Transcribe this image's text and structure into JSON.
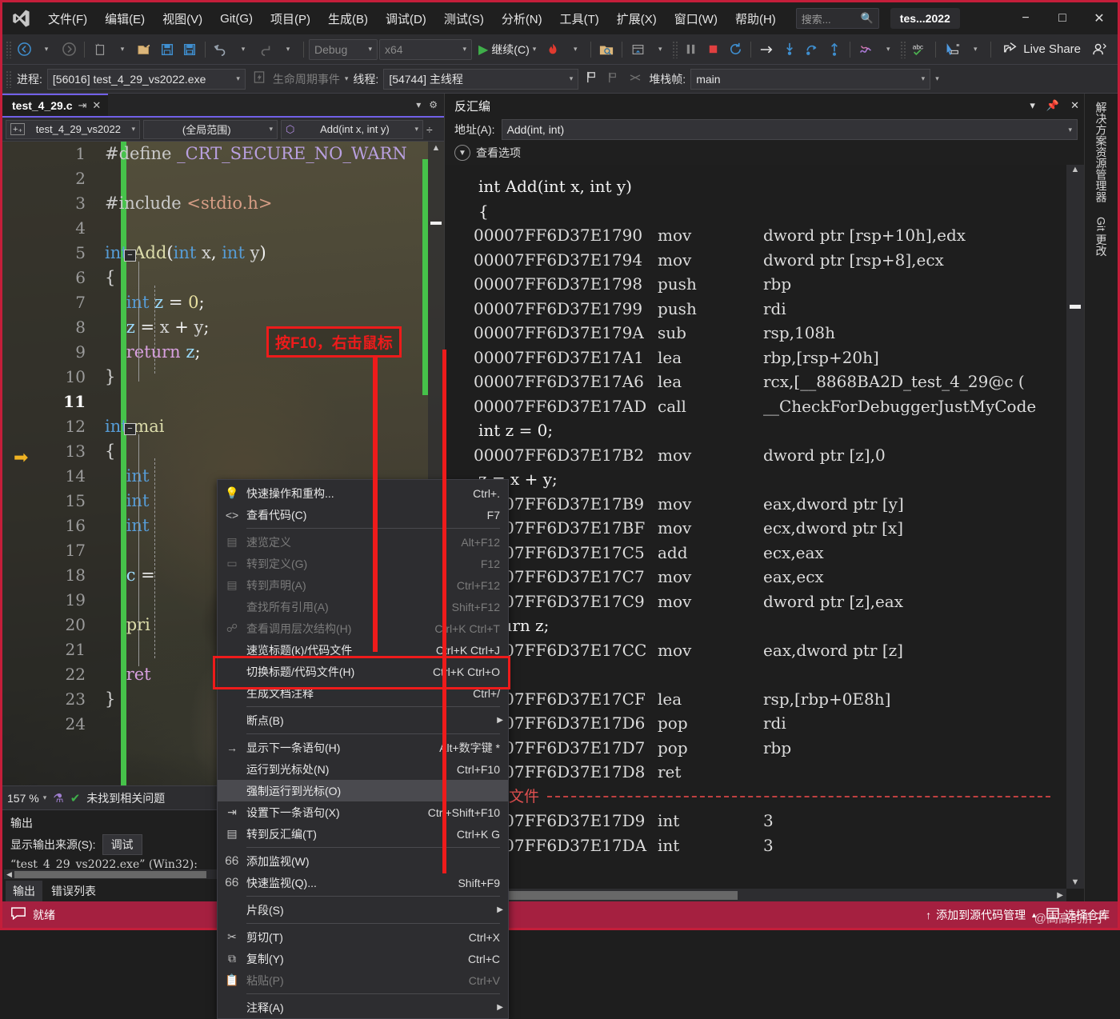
{
  "window": {
    "title": "tes...2022",
    "search_placeholder": "搜索...",
    "minimize": "−",
    "maximize": "□",
    "close": "✕"
  },
  "menubar": {
    "items": [
      {
        "label": "文件(F)"
      },
      {
        "label": "编辑(E)"
      },
      {
        "label": "视图(V)"
      },
      {
        "label": "Git(G)"
      },
      {
        "label": "项目(P)"
      },
      {
        "label": "生成(B)"
      },
      {
        "label": "调试(D)"
      },
      {
        "label": "测试(S)"
      },
      {
        "label": "分析(N)"
      },
      {
        "label": "工具(T)"
      },
      {
        "label": "扩展(X)"
      },
      {
        "label": "窗口(W)"
      },
      {
        "label": "帮助(H)"
      }
    ]
  },
  "toolbar": {
    "config": "Debug",
    "platform": "x64",
    "continue_label": "继续(C)",
    "live_share": "Live Share"
  },
  "debugbar": {
    "process_label": "进程:",
    "process_value": "[56016] test_4_29_vs2022.exe",
    "lifecycle_label": "生命周期事件",
    "thread_label": "线程:",
    "thread_value": "[54744] 主线程",
    "stackframe_label": "堆栈帧:",
    "stackframe_value": "main"
  },
  "editor": {
    "tab_name": "test_4_29.c",
    "nav_project": "test_4_29_vs2022",
    "nav_scope": "(全局范围)",
    "nav_member": "Add(int x, int y)",
    "zoom": "157 %",
    "problems": "未找到相关问题",
    "lines": [
      {
        "n": "1",
        "html": "<span class='pp2'>#define</span> <span class='pp'>_CRT_SECURE_NO_WARN</span>"
      },
      {
        "n": "2",
        "html": ""
      },
      {
        "n": "3",
        "html": "<span class='pp2'>#include</span> <span class='str'>&lt;stdio.h&gt;</span>"
      },
      {
        "n": "4",
        "html": ""
      },
      {
        "n": "5",
        "html": "<span class='k'>int</span> <span class='fn'>Add</span>(<span class='k'>int</span> <span class='pl'>x</span>, <span class='k'>int</span> <span class='pl'>y</span>)"
      },
      {
        "n": "6",
        "html": "<span class='pl'>{</span>"
      },
      {
        "n": "7",
        "html": "    <span class='k'>int</span> <span class='id'>z</span> = <span class='num'>0</span>;"
      },
      {
        "n": "8",
        "html": "    <span class='id'>z</span> = <span class='pl'>x</span> + <span class='pl'>y</span>;"
      },
      {
        "n": "9",
        "html": "    <span class='ret'>return</span> <span class='id'>z</span>;"
      },
      {
        "n": "10",
        "html": "<span class='pl'>}</span>"
      },
      {
        "n": "11",
        "html": "",
        "current": true
      },
      {
        "n": "12",
        "html": "<span class='k'>int</span> <span class='fn'>mai</span>"
      },
      {
        "n": "13",
        "html": "<span class='pl'>{</span>"
      },
      {
        "n": "14",
        "html": "    <span class='k'>int</span>"
      },
      {
        "n": "15",
        "html": "    <span class='k'>int</span>"
      },
      {
        "n": "16",
        "html": "    <span class='k'>int</span>"
      },
      {
        "n": "17",
        "html": ""
      },
      {
        "n": "18",
        "html": "    <span class='id'>c</span> ="
      },
      {
        "n": "19",
        "html": ""
      },
      {
        "n": "20",
        "html": "    <span class='fn'>pri</span>"
      },
      {
        "n": "21",
        "html": ""
      },
      {
        "n": "22",
        "html": "    <span class='ret'>ret</span>"
      },
      {
        "n": "23",
        "html": "<span class='pl'>}</span>"
      },
      {
        "n": "24",
        "html": ""
      }
    ]
  },
  "output": {
    "title": "输出",
    "source_label": "显示输出来源(S):",
    "source_value": "调试",
    "line": "“test_4_29_vs2022.exe” (Win32):",
    "tabs": [
      {
        "label": "输出",
        "active": true
      },
      {
        "label": "错误列表",
        "active": false
      }
    ]
  },
  "disassembly": {
    "title": "反汇编",
    "address_label": "地址(A):",
    "address_value": "Add(int, int)",
    "view_options": "查看选项",
    "no_source_label": "无源文件",
    "rows": [
      {
        "type": "src",
        "text": "int Add(int x, int y)"
      },
      {
        "type": "src",
        "text": "{"
      },
      {
        "type": "asm",
        "addr": "00007FF6D37E1790",
        "mn": "mov",
        "op": "dword ptr [rsp+10h],edx"
      },
      {
        "type": "asm",
        "addr": "00007FF6D37E1794",
        "mn": "mov",
        "op": "dword ptr [rsp+8],ecx"
      },
      {
        "type": "asm",
        "addr": "00007FF6D37E1798",
        "mn": "push",
        "op": "rbp"
      },
      {
        "type": "asm",
        "addr": "00007FF6D37E1799",
        "mn": "push",
        "op": "rdi"
      },
      {
        "type": "asm",
        "addr": "00007FF6D37E179A",
        "mn": "sub",
        "op": "rsp,108h"
      },
      {
        "type": "asm",
        "addr": "00007FF6D37E17A1",
        "mn": "lea",
        "op": "rbp,[rsp+20h]"
      },
      {
        "type": "asm",
        "addr": "00007FF6D37E17A6",
        "mn": "lea",
        "op": "rcx,[__8868BA2D_test_4_29@c ("
      },
      {
        "type": "asm",
        "addr": "00007FF6D37E17AD",
        "mn": "call",
        "op": "__CheckForDebuggerJustMyCode"
      },
      {
        "type": "src",
        "text": "int z = 0;"
      },
      {
        "type": "asm",
        "addr": "00007FF6D37E17B2",
        "mn": "mov",
        "op": "dword ptr [z],0"
      },
      {
        "type": "src",
        "text": "z = x + y;"
      },
      {
        "type": "asm",
        "addr": "00007FF6D37E17B9",
        "mn": "mov",
        "op": "eax,dword ptr [y]"
      },
      {
        "type": "asm",
        "addr": "00007FF6D37E17BF",
        "mn": "mov",
        "op": "ecx,dword ptr [x]"
      },
      {
        "type": "asm",
        "addr": "00007FF6D37E17C5",
        "mn": "add",
        "op": "ecx,eax"
      },
      {
        "type": "asm",
        "addr": "00007FF6D37E17C7",
        "mn": "mov",
        "op": "eax,ecx"
      },
      {
        "type": "asm",
        "addr": "00007FF6D37E17C9",
        "mn": "mov",
        "op": "dword ptr [z],eax"
      },
      {
        "type": "src",
        "text": "return z;"
      },
      {
        "type": "asm",
        "addr": "00007FF6D37E17CC",
        "mn": "mov",
        "op": "eax,dword ptr [z]"
      },
      {
        "type": "src",
        "text": "}"
      },
      {
        "type": "asm",
        "addr": "00007FF6D37E17CF",
        "mn": "lea",
        "op": "rsp,[rbp+0E8h]"
      },
      {
        "type": "asm",
        "addr": "00007FF6D37E17D6",
        "mn": "pop",
        "op": "rdi"
      },
      {
        "type": "asm",
        "addr": "00007FF6D37E17D7",
        "mn": "pop",
        "op": "rbp"
      },
      {
        "type": "asm",
        "addr": "00007FF6D37E17D8",
        "mn": "ret",
        "op": ""
      },
      {
        "type": "nosrc"
      },
      {
        "type": "asm",
        "addr": "00007FF6D37E17D9",
        "mn": "int",
        "op": "3"
      },
      {
        "type": "asm",
        "addr": "00007FF6D37E17DA",
        "mn": "int",
        "op": "3"
      }
    ]
  },
  "vertical_tabs": [
    {
      "label": "解决方案资源管理器"
    },
    {
      "label": "Git 更改"
    }
  ],
  "context_menu": {
    "items": [
      {
        "icon": "💡",
        "label": "快速操作和重构...",
        "shortcut": "Ctrl+.",
        "state": "normal"
      },
      {
        "icon": "<>",
        "label": "查看代码(C)",
        "shortcut": "F7",
        "state": "normal"
      },
      {
        "sep": true
      },
      {
        "icon": "▤",
        "label": "速览定义",
        "shortcut": "Alt+F12",
        "state": "disabled"
      },
      {
        "icon": "▭",
        "label": "转到定义(G)",
        "shortcut": "F12",
        "state": "disabled"
      },
      {
        "icon": "▤",
        "label": "转到声明(A)",
        "shortcut": "Ctrl+F12",
        "state": "disabled"
      },
      {
        "icon": "",
        "label": "查找所有引用(A)",
        "shortcut": "Shift+F12",
        "state": "disabled"
      },
      {
        "icon": "☍",
        "label": "查看调用层次结构(H)",
        "shortcut": "Ctrl+K Ctrl+T",
        "state": "disabled"
      },
      {
        "icon": "",
        "label": "速览标题(k)/代码文件",
        "shortcut": "Ctrl+K Ctrl+J",
        "state": "normal"
      },
      {
        "icon": "",
        "label": "切换标题/代码文件(H)",
        "shortcut": "Ctrl+K Ctrl+O",
        "state": "normal"
      },
      {
        "icon": "",
        "label": "生成文档注释",
        "shortcut": "Ctrl+/",
        "state": "normal"
      },
      {
        "sep": true
      },
      {
        "icon": "",
        "label": "断点(B)",
        "shortcut": "",
        "state": "normal",
        "submenu": true
      },
      {
        "sep": true
      },
      {
        "icon": "→",
        "label": "显示下一条语句(H)",
        "shortcut": "Alt+数字键 *",
        "state": "normal"
      },
      {
        "icon": "",
        "label": "运行到光标处(N)",
        "shortcut": "Ctrl+F10",
        "state": "normal"
      },
      {
        "icon": "",
        "label": "强制运行到光标(O)",
        "shortcut": "",
        "state": "selected"
      },
      {
        "icon": "⇥",
        "label": "设置下一条语句(X)",
        "shortcut": "Ctrl+Shift+F10",
        "state": "normal"
      },
      {
        "icon": "▤",
        "label": "转到反汇编(T)",
        "shortcut": "Ctrl+K G",
        "state": "normal",
        "highlight": true
      },
      {
        "sep": true
      },
      {
        "icon": "ᏮᏮ",
        "label": "添加监视(W)",
        "shortcut": "",
        "state": "normal"
      },
      {
        "icon": "ᏮᏮ",
        "label": "快速监视(Q)...",
        "shortcut": "Shift+F9",
        "state": "normal"
      },
      {
        "sep": true
      },
      {
        "icon": "",
        "label": "片段(S)",
        "shortcut": "",
        "state": "normal",
        "submenu": true
      },
      {
        "sep": true
      },
      {
        "icon": "✂",
        "label": "剪切(T)",
        "shortcut": "Ctrl+X",
        "state": "normal"
      },
      {
        "icon": "⧉",
        "label": "复制(Y)",
        "shortcut": "Ctrl+C",
        "state": "normal"
      },
      {
        "icon": "📋",
        "label": "粘贴(P)",
        "shortcut": "Ctrl+V",
        "state": "disabled"
      },
      {
        "sep": true
      },
      {
        "icon": "",
        "label": "注释(A)",
        "shortcut": "",
        "state": "normal",
        "submenu": true
      }
    ]
  },
  "annotations": {
    "hint_f10": "按F10，右击鼠标"
  },
  "statusbar": {
    "ready": "就绪",
    "add_to_source_control": "添加到源代码管理",
    "select_repo": "选择仓库",
    "watermark": "@高高的胖子"
  },
  "colors": {
    "accent_red": "#c41e3a",
    "status_bar": "#a52040",
    "annotation_red": "#ee1b1b",
    "tab_purple": "#7160e8",
    "change_green": "#46c24a"
  }
}
